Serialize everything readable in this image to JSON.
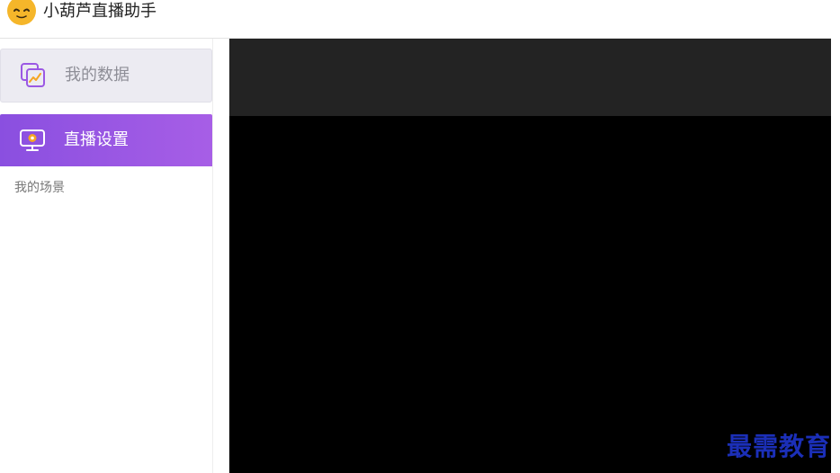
{
  "app": {
    "title": "小葫芦直播助手",
    "logo_icon": "mascot-face-icon",
    "accent_color": "#9b58e4"
  },
  "sidebar": {
    "items": [
      {
        "label": "我的数据",
        "icon": "data-chart-icon",
        "active": false
      },
      {
        "label": "直播设置",
        "icon": "monitor-icon",
        "active": true
      }
    ],
    "section_label": "我的场景"
  },
  "watermark": {
    "text": "最需教育"
  }
}
